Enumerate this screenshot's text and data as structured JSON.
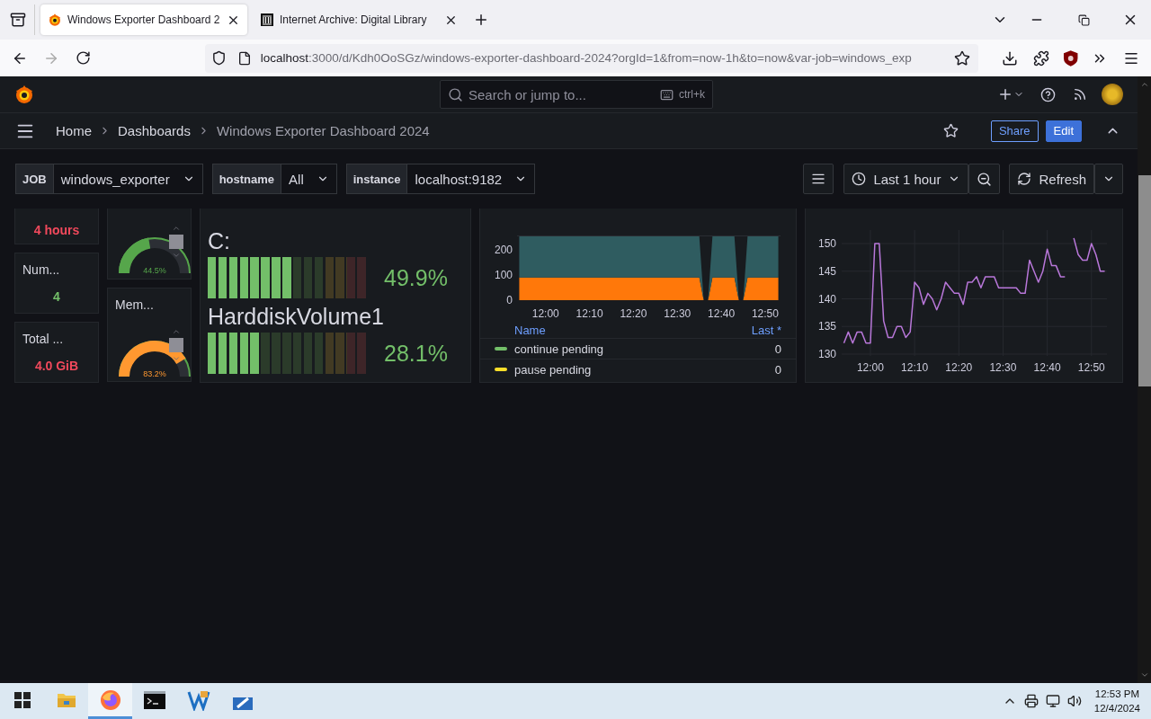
{
  "browser": {
    "tabs": [
      {
        "title": "Windows Exporter Dashboard 2",
        "kind": "grafana",
        "selected": true
      },
      {
        "title": "Internet Archive: Digital Library",
        "kind": "archive",
        "selected": false
      }
    ],
    "url_host": "localhost",
    "url_rest": ":3000/d/Kdh0OoSGz/windows-exporter-dashboard-2024?orgId=1&from=now-1h&to=now&var-job=windows_exp"
  },
  "topbar": {
    "search_placeholder": "Search or jump to...",
    "shortcut": "ctrl+k"
  },
  "breadcrumbs": [
    "Home",
    "Dashboards",
    "Windows Exporter Dashboard 2024"
  ],
  "actions": {
    "share": "Share",
    "edit": "Edit"
  },
  "variables": [
    {
      "label": "JOB",
      "value": "windows_exporter"
    },
    {
      "label": "hostname",
      "value": "All"
    },
    {
      "label": "instance",
      "value": "localhost:9182"
    }
  ],
  "time_range": "Last 1 hour",
  "refresh": "Refresh",
  "stats": [
    {
      "value": "4 hours",
      "color": "#f2495c"
    },
    {
      "title": "Num...",
      "value": "4",
      "color": "#73bf69"
    },
    {
      "title": "Total ...",
      "value": "4.0 GiB",
      "color": "#f2495c"
    }
  ],
  "gauges": [
    {
      "reading": "44.5%",
      "color": "#56a64b"
    },
    {
      "title": "Mem...",
      "reading": "83.2%",
      "color": "#ff9830"
    }
  ],
  "bar_gauges": [
    {
      "name": "C:",
      "level": 0.499,
      "reading": "49.9%"
    },
    {
      "name": "HarddiskVolume1",
      "level": 0.281,
      "reading": "28.1%"
    }
  ],
  "area_panel": {
    "chart_data": {
      "type": "area",
      "stacked": true,
      "categories": [
        null,
        null,
        null,
        null,
        null,
        null,
        "12:00",
        null,
        null,
        null,
        null,
        null,
        null,
        null,
        null,
        null,
        "12:10",
        null,
        null,
        null,
        null,
        null,
        null,
        null,
        null,
        null,
        "12:20",
        null,
        null,
        null,
        null,
        null,
        null,
        null,
        null,
        null,
        "12:30",
        null,
        null,
        null,
        null,
        null,
        null,
        null,
        null,
        null,
        "12:40",
        null,
        null,
        null,
        null,
        null,
        null,
        null,
        null,
        null,
        "12:50",
        null,
        null,
        null
      ],
      "ylim": [
        0,
        254
      ],
      "yticks": [
        0,
        100,
        200
      ],
      "series": [
        {
          "color": "#ff780a",
          "values": [
            90,
            90,
            90,
            90,
            90,
            90,
            90,
            90,
            90,
            90,
            90,
            90,
            90,
            90,
            90,
            90,
            90,
            90,
            90,
            90,
            90,
            90,
            90,
            90,
            90,
            90,
            90,
            90,
            90,
            90,
            90,
            90,
            90,
            90,
            90,
            90,
            90,
            90,
            90,
            90,
            90,
            90,
            0,
            0,
            90,
            90,
            90,
            90,
            90,
            90,
            0,
            0,
            90,
            90,
            90,
            90,
            90,
            90,
            90,
            90
          ]
        },
        {
          "color": "#2f5c60",
          "values": [
            164,
            164,
            164,
            164,
            164,
            164,
            164,
            164,
            164,
            164,
            164,
            164,
            164,
            164,
            164,
            164,
            164,
            164,
            164,
            164,
            164,
            164,
            164,
            164,
            164,
            164,
            164,
            164,
            164,
            164,
            164,
            164,
            164,
            164,
            164,
            164,
            164,
            164,
            164,
            164,
            164,
            164,
            0,
            0,
            164,
            164,
            164,
            164,
            164,
            164,
            0,
            0,
            164,
            164,
            164,
            164,
            164,
            164,
            164,
            164
          ]
        }
      ]
    },
    "legend": {
      "columns": [
        "Name",
        "Last *"
      ],
      "rows": [
        {
          "name": "continue pending",
          "value": "0",
          "color": "#73bf69"
        },
        {
          "name": "pause pending",
          "value": "0",
          "color": "#fade2a"
        }
      ]
    }
  },
  "line_panel": {
    "chart_data": {
      "type": "line",
      "categories": [
        null,
        null,
        null,
        null,
        null,
        null,
        "12:00",
        null,
        null,
        null,
        null,
        null,
        null,
        null,
        null,
        null,
        "12:10",
        null,
        null,
        null,
        null,
        null,
        null,
        null,
        null,
        null,
        "12:20",
        null,
        null,
        null,
        null,
        null,
        null,
        null,
        null,
        null,
        "12:30",
        null,
        null,
        null,
        null,
        null,
        null,
        null,
        null,
        null,
        "12:40",
        null,
        null,
        null,
        null,
        null,
        null,
        null,
        null,
        null,
        "12:50",
        null,
        null,
        null
      ],
      "ylim": [
        130,
        152
      ],
      "yticks": [
        130,
        135,
        140,
        145,
        150
      ],
      "grid": true,
      "series": [
        {
          "color": "#b877d9",
          "values": [
            132,
            134,
            132,
            134,
            134,
            132,
            132,
            150,
            150,
            136,
            133,
            133,
            135,
            135,
            133,
            134,
            143,
            142,
            139,
            141,
            140,
            138,
            140,
            143,
            142,
            141,
            141,
            139,
            143,
            143,
            144,
            142,
            144,
            144,
            144,
            142,
            142,
            142,
            142,
            142,
            141,
            141,
            147,
            145,
            143,
            145,
            149,
            146,
            146,
            144,
            144,
            null,
            151,
            148,
            147,
            147,
            150,
            148,
            145,
            145
          ]
        }
      ]
    }
  },
  "taskbar": {
    "apps": [
      {
        "kind": "explorer",
        "selected": false
      },
      {
        "kind": "firefox",
        "selected": true
      },
      {
        "kind": "terminal",
        "selected": false
      },
      {
        "kind": "code",
        "selected": false
      },
      {
        "kind": "tool",
        "selected": false
      }
    ],
    "time": "12:53 PM",
    "date": "12/4/2024"
  }
}
